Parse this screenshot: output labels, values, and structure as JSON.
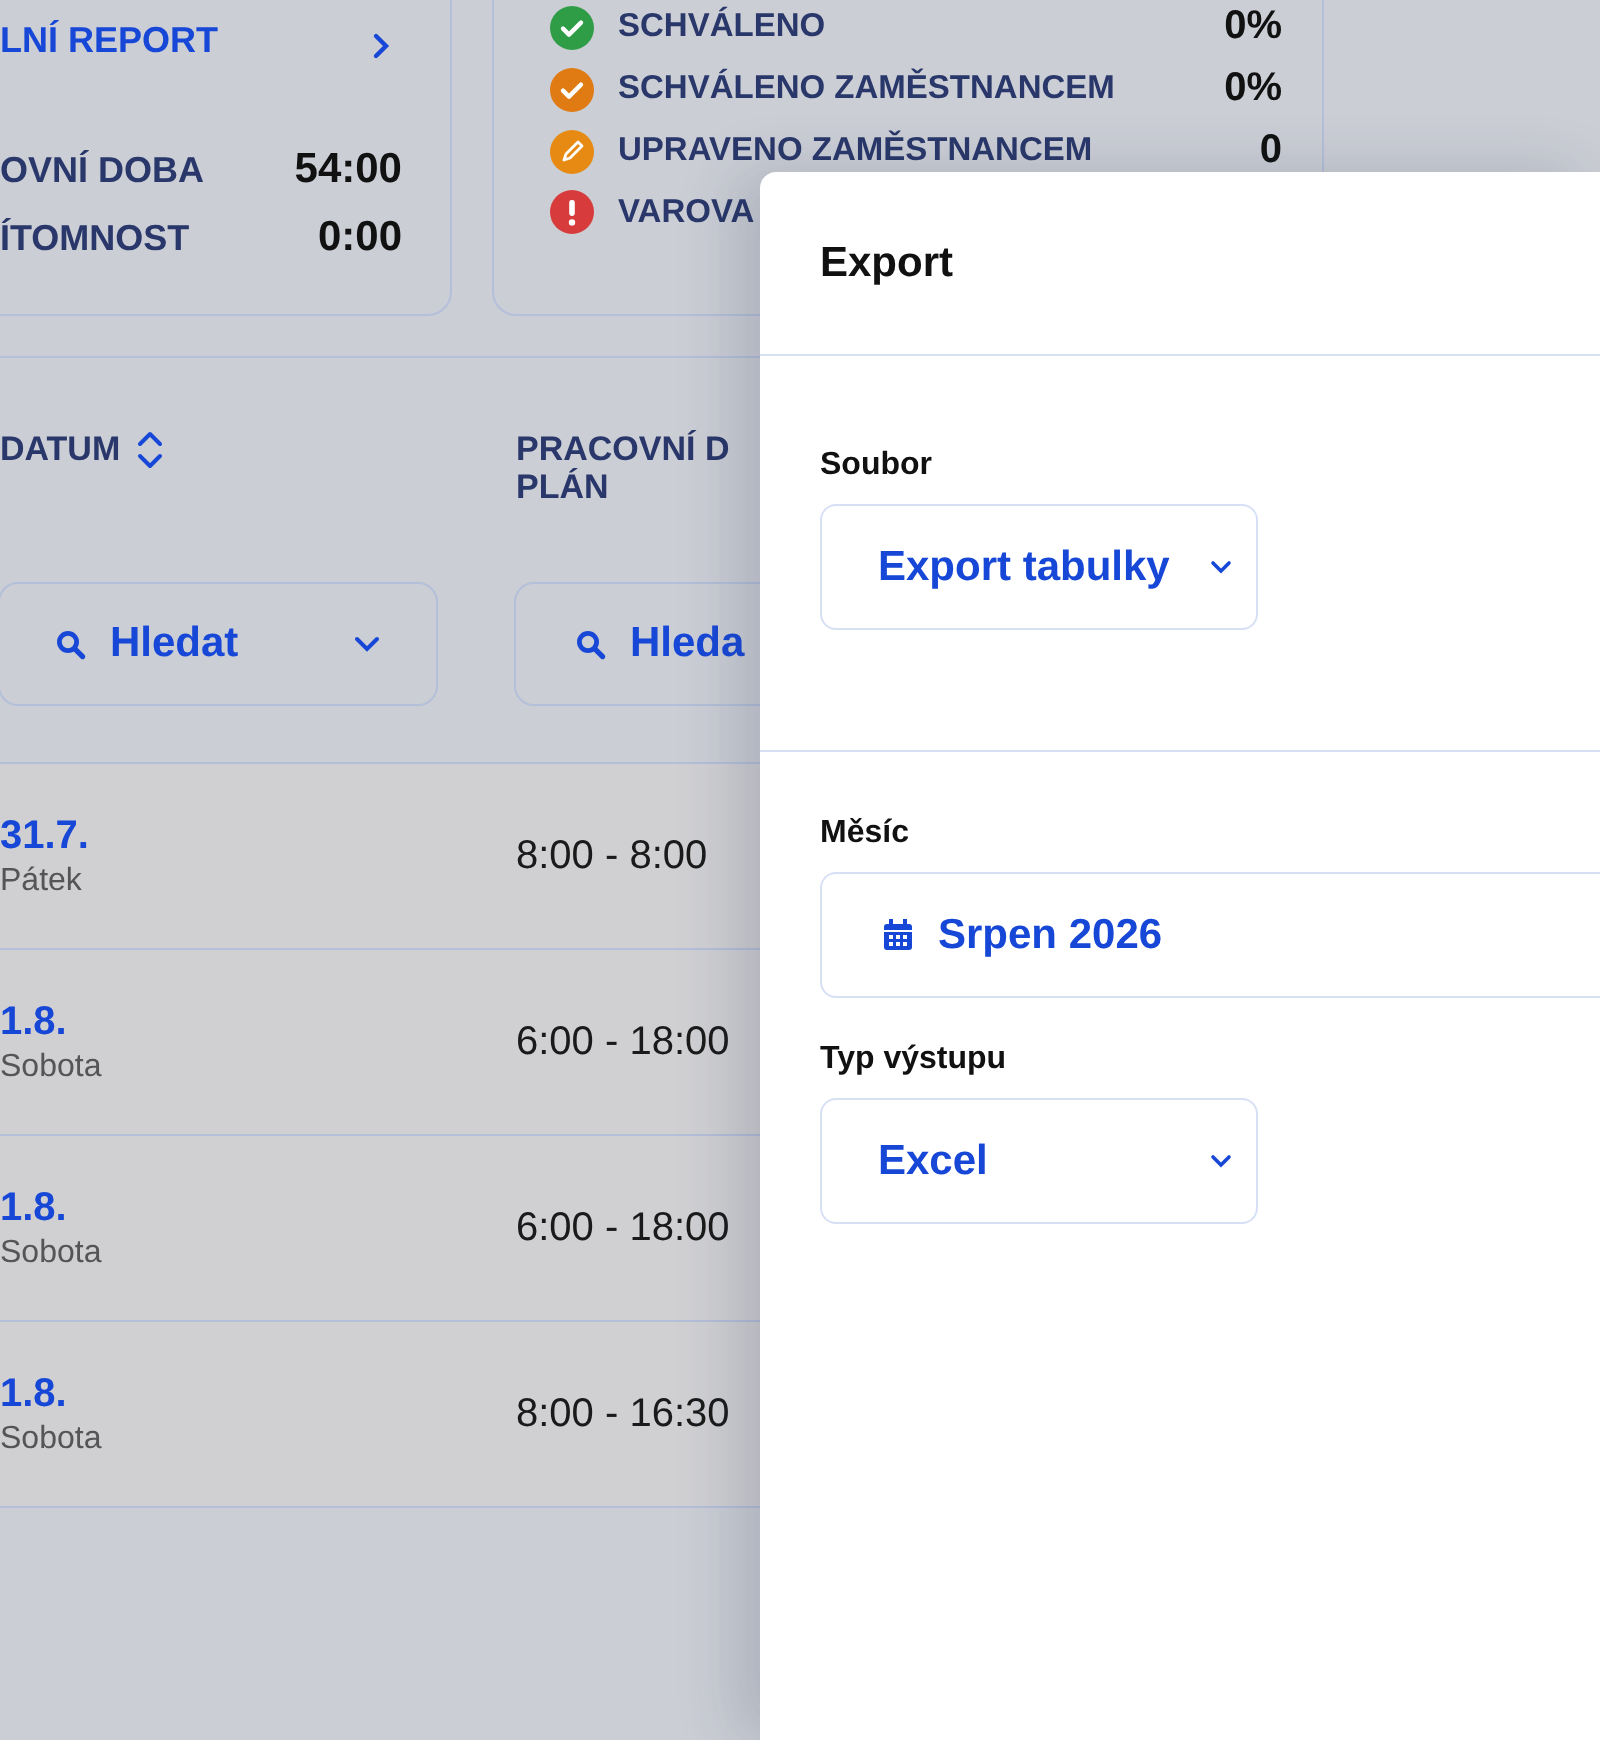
{
  "summary_card": {
    "link": "LNÍ REPORT",
    "rows": [
      {
        "label": "OVNÍ DOBA",
        "value": "54:00"
      },
      {
        "label": "ÍTOMNOST",
        "value": "0:00"
      }
    ]
  },
  "status_card": {
    "items": [
      {
        "kind": "approved",
        "label": "SCHVÁLENO",
        "value": "0%"
      },
      {
        "kind": "approved_by_employee",
        "label": "SCHVÁLENO ZAMĚSTNANCEM",
        "value": "0%"
      },
      {
        "kind": "edited",
        "label": "UPRAVENO ZAMĚSTNANCEM",
        "value": "0"
      },
      {
        "kind": "warning",
        "label": "VAROVA"
      }
    ]
  },
  "table": {
    "columns": [
      {
        "title_lines": [
          "DATUM"
        ],
        "sortable": true,
        "filter": "Hledat",
        "dropdown": true
      },
      {
        "title_lines": [
          "PRACOVNÍ D",
          "PLÁN"
        ],
        "sortable": false,
        "filter": "Hleda"
      }
    ],
    "rows": [
      {
        "date": "31.7.",
        "day": "Pátek",
        "plan": "8:00 - 8:00"
      },
      {
        "date": "1.8.",
        "day": "Sobota",
        "plan": "6:00 - 18:00"
      },
      {
        "date": "1.8.",
        "day": "Sobota",
        "plan": "6:00 - 18:00"
      },
      {
        "date": "1.8.",
        "day": "Sobota",
        "plan": "8:00 - 16:30"
      }
    ]
  },
  "modal": {
    "title": "Export",
    "sections": [
      {
        "fields": [
          {
            "kind": "select",
            "label": "Soubor",
            "value": "Export tabulky"
          }
        ]
      },
      {
        "fields": [
          {
            "kind": "month",
            "label": "Měsíc",
            "value": "Srpen 2026"
          },
          {
            "kind": "select",
            "label": "Typ výstupu",
            "value": "Excel"
          }
        ]
      }
    ]
  }
}
